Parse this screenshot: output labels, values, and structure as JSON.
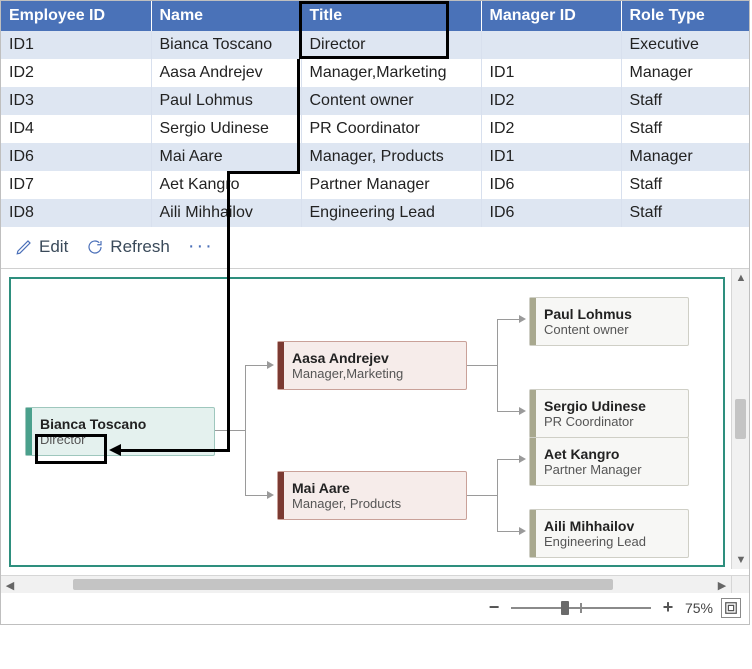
{
  "table": {
    "headers": [
      "Employee ID",
      "Name",
      "Title",
      "Manager ID",
      "Role Type"
    ],
    "rows": [
      {
        "id": "ID1",
        "name": "Bianca Toscano",
        "title": "Director",
        "mgr": "",
        "role": "Executive"
      },
      {
        "id": "ID2",
        "name": "Aasa Andrejev",
        "title": "Manager,Marketing",
        "mgr": "ID1",
        "role": "Manager"
      },
      {
        "id": "ID3",
        "name": "Paul Lohmus",
        "title": "Content owner",
        "mgr": "ID2",
        "role": "Staff"
      },
      {
        "id": "ID4",
        "name": "Sergio Udinese",
        "title": "PR Coordinator",
        "mgr": "ID2",
        "role": "Staff"
      },
      {
        "id": "ID6",
        "name": "Mai Aare",
        "title": "Manager, Products",
        "mgr": "ID1",
        "role": "Manager"
      },
      {
        "id": "ID7",
        "name": "Aet Kangro",
        "title": "Partner Manager",
        "mgr": "ID6",
        "role": "Staff"
      },
      {
        "id": "ID8",
        "name": "Aili Mihhailov",
        "title": "Engineering Lead",
        "mgr": "ID6",
        "role": "Staff"
      }
    ]
  },
  "toolbar": {
    "edit": "Edit",
    "refresh": "Refresh"
  },
  "org": {
    "root": {
      "name": "Bianca Toscano",
      "title": "Director"
    },
    "mgrs": [
      {
        "name": "Aasa Andrejev",
        "title": "Manager,Marketing"
      },
      {
        "name": "Mai Aare",
        "title": "Manager, Products"
      }
    ],
    "staff": [
      {
        "name": "Paul Lohmus",
        "title": "Content owner"
      },
      {
        "name": "Sergio Udinese",
        "title": "PR Coordinator"
      },
      {
        "name": "Aet Kangro",
        "title": "Partner Manager"
      },
      {
        "name": "Aili Mihhailov",
        "title": "Engineering Lead"
      }
    ]
  },
  "zoom": {
    "value": "75%"
  }
}
